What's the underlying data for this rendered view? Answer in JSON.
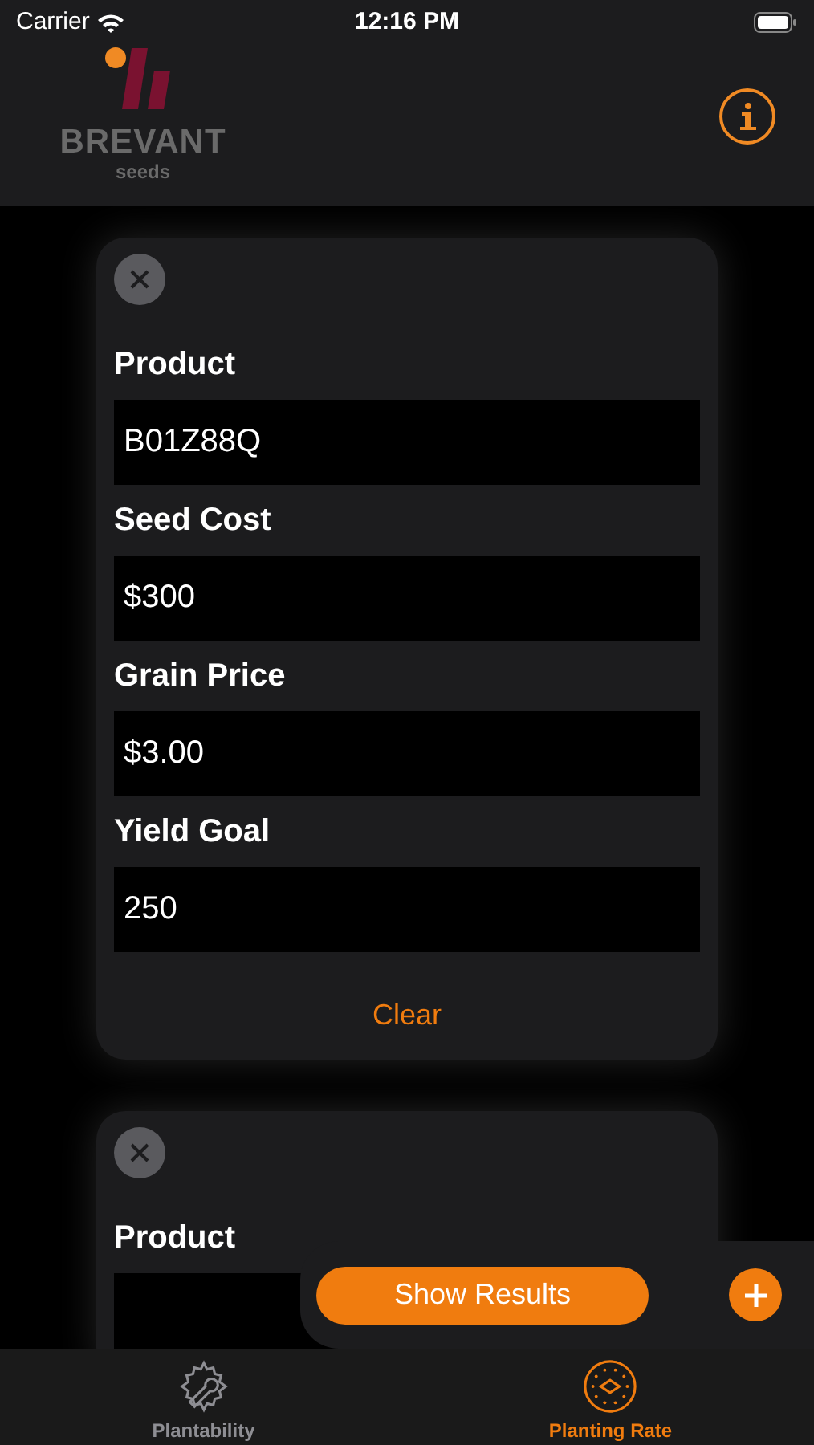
{
  "status_bar": {
    "carrier": "Carrier",
    "time": "12:16 PM"
  },
  "header": {
    "brand": "BREVANT",
    "tagline": "seeds"
  },
  "cards": [
    {
      "fields": [
        {
          "label": "Product",
          "value": "B01Z88Q"
        },
        {
          "label": "Seed Cost",
          "value": "$300"
        },
        {
          "label": "Grain Price",
          "value": "$3.00"
        },
        {
          "label": "Yield Goal",
          "value": "250"
        }
      ],
      "clear_label": "Clear"
    },
    {
      "fields": [
        {
          "label": "Product"
        }
      ]
    }
  ],
  "actions": {
    "show_results": "Show Results"
  },
  "tabs": [
    {
      "label": "Plantability",
      "selected": false,
      "kind": "gear"
    },
    {
      "label": "Planting Rate",
      "selected": true,
      "kind": "dial"
    }
  ]
}
